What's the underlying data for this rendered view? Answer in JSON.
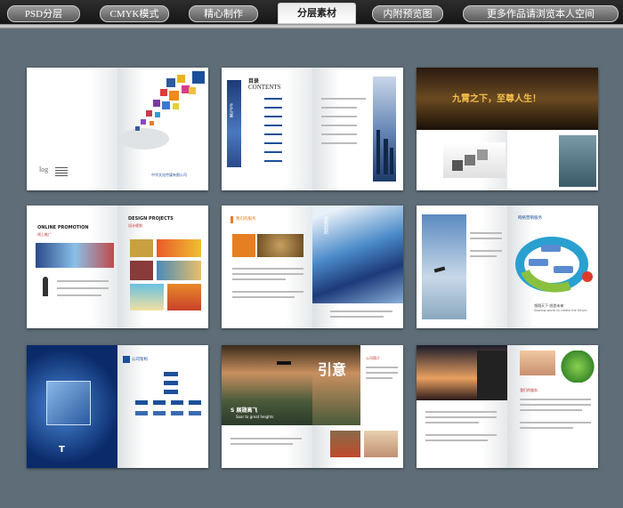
{
  "topbar": {
    "tabs": [
      "PSD分层",
      "CMYK模式",
      "精心制作",
      "分层素材",
      "内附预览图",
      "更多作品请浏览本人空间"
    ],
    "active_index": 3
  },
  "spreads": {
    "s1": {
      "logo": "log",
      "company": "中华文化传媒有限公司"
    },
    "s2": {
      "contents_cn": "目录",
      "contents_en": "CONTENTS",
      "cover_text": "步步为赢",
      "cover_text_en": "STEP BY STEP TO WIN"
    },
    "s3": {
      "headline": "九霄之下，至尊人生！"
    },
    "s4": {
      "online": "ONLINE PROMOTION",
      "online_cn": "线上推广",
      "design": "DESIGN PROJECTS",
      "design_cn": "设计规划"
    },
    "s5": {
      "section": "我们的服务",
      "vertical": "扬帆起航"
    },
    "s6": {
      "section": "网络营销服务",
      "caption": "领翔天下 创造未来",
      "caption_en": "Soaring world to create the future"
    },
    "s7": {
      "section": "公司架构",
      "corner": "T"
    },
    "s8": {
      "brand": "引意",
      "tag": "S 展翅高飞",
      "tag_en": "Soar to great heights",
      "section": "公司简介"
    },
    "s9": {
      "section": "我们的服务"
    }
  },
  "colors": {
    "background": "#5e6d77",
    "accent_blue": "#1d4f9a",
    "accent_orange": "#e67e22"
  }
}
